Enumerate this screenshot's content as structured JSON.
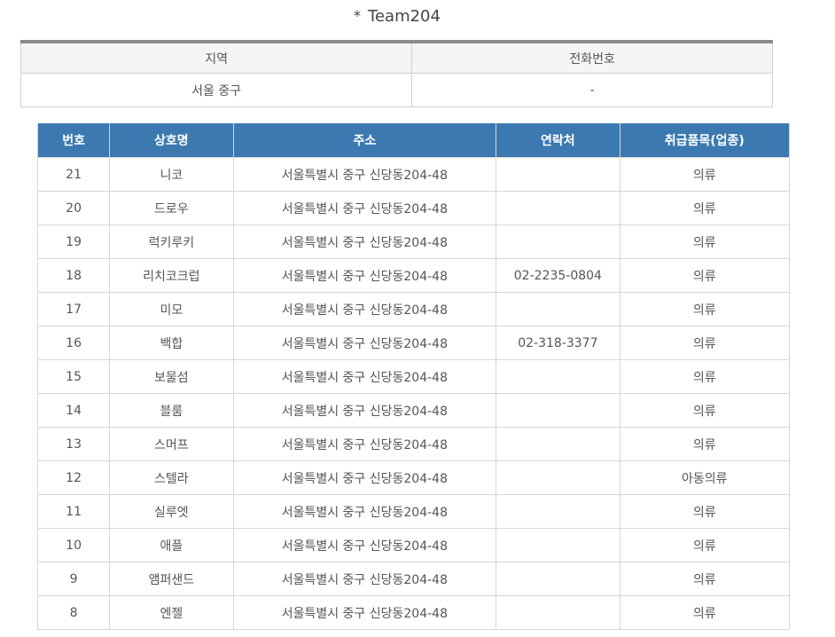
{
  "page": {
    "title_bullet": "*",
    "title": "Team204"
  },
  "info": {
    "headers": {
      "region": "지역",
      "phone": "전화번호"
    },
    "values": {
      "region": "서울 중구",
      "phone": "-"
    }
  },
  "stores": {
    "headers": {
      "num": "번호",
      "name": "상호명",
      "address": "주소",
      "contact": "연락처",
      "items": "취급품목(업종)"
    },
    "rows": [
      {
        "num": "21",
        "name": "니코",
        "address": "서울특별시 중구 신당동204-48",
        "contact": "",
        "items": "의류"
      },
      {
        "num": "20",
        "name": "드로우",
        "address": "서울특별시 중구 신당동204-48",
        "contact": "",
        "items": "의류"
      },
      {
        "num": "19",
        "name": "럭키루키",
        "address": "서울특별시 중구 신당동204-48",
        "contact": "",
        "items": "의류"
      },
      {
        "num": "18",
        "name": "리치코크럽",
        "address": "서울특별시 중구 신당동204-48",
        "contact": "02-2235-0804",
        "items": "의류"
      },
      {
        "num": "17",
        "name": "미모",
        "address": "서울특별시 중구 신당동204-48",
        "contact": "",
        "items": "의류"
      },
      {
        "num": "16",
        "name": "백합",
        "address": "서울특별시 중구 신당동204-48",
        "contact": "02-318-3377",
        "items": "의류"
      },
      {
        "num": "15",
        "name": "보물섬",
        "address": "서울특별시 중구 신당동204-48",
        "contact": "",
        "items": "의류"
      },
      {
        "num": "14",
        "name": "블룸",
        "address": "서울특별시 중구 신당동204-48",
        "contact": "",
        "items": "의류"
      },
      {
        "num": "13",
        "name": "스머프",
        "address": "서울특별시 중구 신당동204-48",
        "contact": "",
        "items": "의류"
      },
      {
        "num": "12",
        "name": "스텔라",
        "address": "서울특별시 중구 신당동204-48",
        "contact": "",
        "items": "아동의류"
      },
      {
        "num": "11",
        "name": "실루엣",
        "address": "서울특별시 중구 신당동204-48",
        "contact": "",
        "items": "의류"
      },
      {
        "num": "10",
        "name": "애플",
        "address": "서울특별시 중구 신당동204-48",
        "contact": "",
        "items": "의류"
      },
      {
        "num": "9",
        "name": "앰퍼샌드",
        "address": "서울특별시 중구 신당동204-48",
        "contact": "",
        "items": "의류"
      },
      {
        "num": "8",
        "name": "엔젤",
        "address": "서울특별시 중구 신당동204-48",
        "contact": "",
        "items": "의류"
      }
    ]
  },
  "colors": {
    "header_blue": "#3c79b0",
    "info_header_bg": "#f5f5f5",
    "info_top_border": "#8a8a8a"
  }
}
